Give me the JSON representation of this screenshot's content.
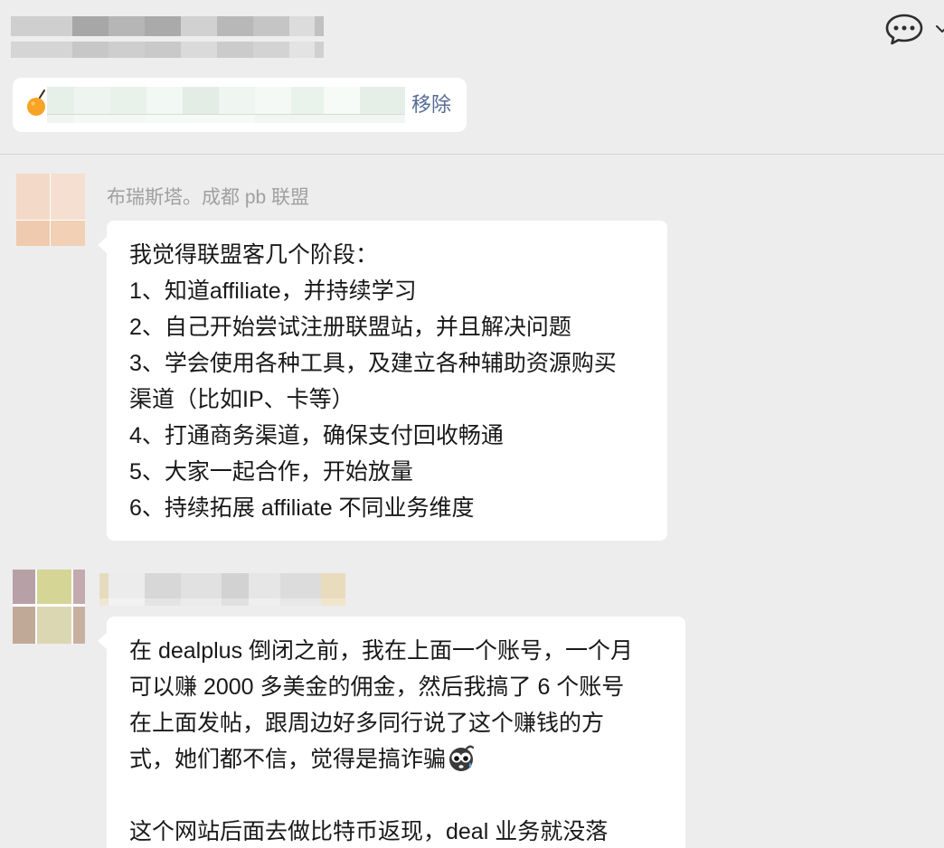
{
  "header": {
    "chat_icon": "chat-bubble-dots-icon",
    "dropdown_icon": "chevron-down-icon"
  },
  "notice": {
    "icon": "orange-icon",
    "remove_label": "移除"
  },
  "messages": [
    {
      "sender": "布瑞斯塔。成都 pb 联盟",
      "lines": [
        "我觉得联盟客几个阶段：",
        "1、知道affiliate，并持续学习",
        "2、自己开始尝试注册联盟站，并且解决问题",
        "3、学会使用各种工具，及建立各种辅助资源购买",
        "渠道（比如IP、卡等）",
        "4、打通商务渠道，确保支付回收畅通",
        "5、大家一起合作，开始放量",
        "6、持续拓展 affiliate 不同业务维度"
      ]
    },
    {
      "lines": [
        "在 dealplus 倒闭之前，我在上面一个账号，一个月",
        "可以赚 2000 多美金的佣金，然后我搞了 6 个账号",
        "在上面发帖，跟周边好多同行说了这个赚钱的方",
        "式，她们都不信，觉得是搞诈骗",
        "",
        "这个网站后面去做比特币返现，deal 业务就没落"
      ],
      "emoji": "scared-face-emoji-icon"
    }
  ],
  "colors": {
    "background": "#ededed",
    "bubble": "#ffffff",
    "link": "#576b95",
    "sender_text": "#a0a0a0",
    "message_text": "#191919",
    "divider": "#d6d6d6"
  }
}
